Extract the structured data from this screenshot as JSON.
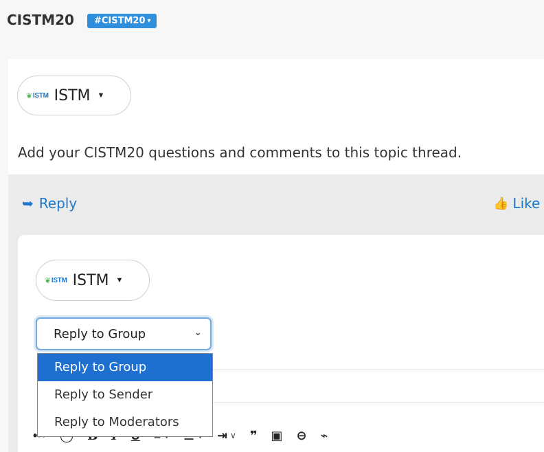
{
  "header": {
    "title": "CISTM20",
    "tag_label": "#CISTM20",
    "tag_caret": "▾"
  },
  "post": {
    "author": {
      "logo_text": "ISTM",
      "logo_sprout": "❦",
      "name": "ISTM",
      "caret": "▼"
    },
    "body": "Add your CISTM20 questions and comments to this topic thread."
  },
  "actions": {
    "reply_icon": "➥",
    "reply_label": "Reply",
    "like_icon": "👍",
    "like_label": "Like"
  },
  "composer": {
    "author": {
      "logo_text": "ISTM",
      "logo_sprout": "❦",
      "name": "ISTM",
      "caret": "▼"
    },
    "reply_to": {
      "selected": "Reply to Group",
      "chevron": "⌄",
      "options": [
        "Reply to Group",
        "Reply to Sender",
        "Reply to Moderators"
      ]
    },
    "toolbar": {
      "more": "•••",
      "speech": "◯",
      "bold": "B",
      "italic": "I",
      "underline": "U",
      "align": "≡",
      "list": "☰",
      "indent": "⇥",
      "quote": "❞",
      "image": "▣",
      "link": "⊖",
      "attach": "⌁",
      "dd": "∨"
    }
  },
  "colors": {
    "accent": "#1e77c9",
    "tag_bg": "#2f8fdd",
    "selected_option_bg": "#1e6fd0"
  }
}
